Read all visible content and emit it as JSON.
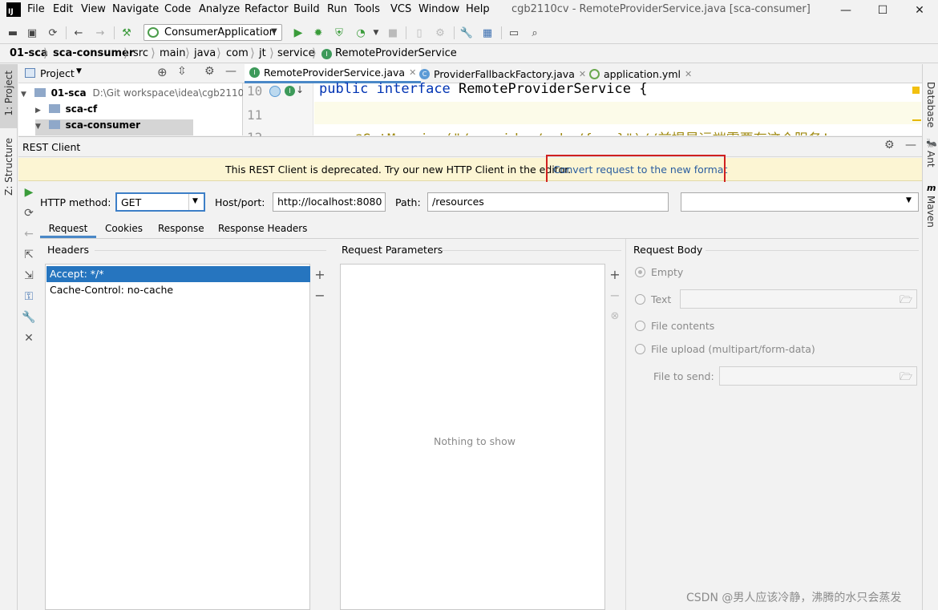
{
  "menubar": {
    "items": [
      "File",
      "Edit",
      "View",
      "Navigate",
      "Code",
      "Analyze",
      "Refactor",
      "Build",
      "Run",
      "Tools",
      "VCS",
      "Window",
      "Help"
    ],
    "window_title": "cgb2110cv - RemoteProviderService.java [sca-consumer]"
  },
  "toolbar": {
    "run_config": "ConsumerApplication"
  },
  "breadcrumb": [
    "01-sca",
    "sca-consumer",
    "src",
    "main",
    "java",
    "com",
    "jt",
    "service",
    "RemoteProviderService"
  ],
  "left_strip": {
    "project": "1: Project",
    "structure": "Z: Structure"
  },
  "right_strip": {
    "database": "Database",
    "ant": "Ant",
    "maven": "Maven"
  },
  "project_panel": {
    "title": "Project",
    "root_name": "01-sca",
    "root_path": "D:\\Git workspace\\idea\\cgb2110cv",
    "child1": "sca-cf",
    "child2": "sca-consumer"
  },
  "editor": {
    "tabs": [
      "RemoteProviderService.java",
      "ProviderFallbackFactory.java",
      "application.yml"
    ],
    "line_numbers": [
      "10",
      "11",
      "12"
    ],
    "line10_kw1": "public",
    "line10_kw2": "interface",
    "line10_name": "RemoteProviderService {",
    "line12_partial": "@GetMapping(\"/provider/echo/{msg}\")//前提是远端需要有这个服务!"
  },
  "rest_client": {
    "title": "REST Client",
    "banner_text": "This REST Client is deprecated. Try our new HTTP Client in the editor.",
    "banner_link": "Convert request to the new format",
    "http_method_label": "HTTP method:",
    "http_method_value": "GET",
    "host_label": "Host/port:",
    "host_value": "http://localhost:8080",
    "path_label": "Path:",
    "path_value": "/resources",
    "subtabs": [
      "Request",
      "Cookies",
      "Response",
      "Response Headers"
    ],
    "headers_title": "Headers",
    "headers": [
      "Accept: */*",
      "Cache-Control: no-cache"
    ],
    "params_title": "Request Parameters",
    "params_empty": "Nothing to show",
    "body_title": "Request Body",
    "body_options": [
      "Empty",
      "Text",
      "File contents",
      "File upload (multipart/form-data)"
    ],
    "file_to_send_label": "File to send:"
  },
  "watermark": "CSDN @男人应该冷静，沸腾的水只会蒸发"
}
